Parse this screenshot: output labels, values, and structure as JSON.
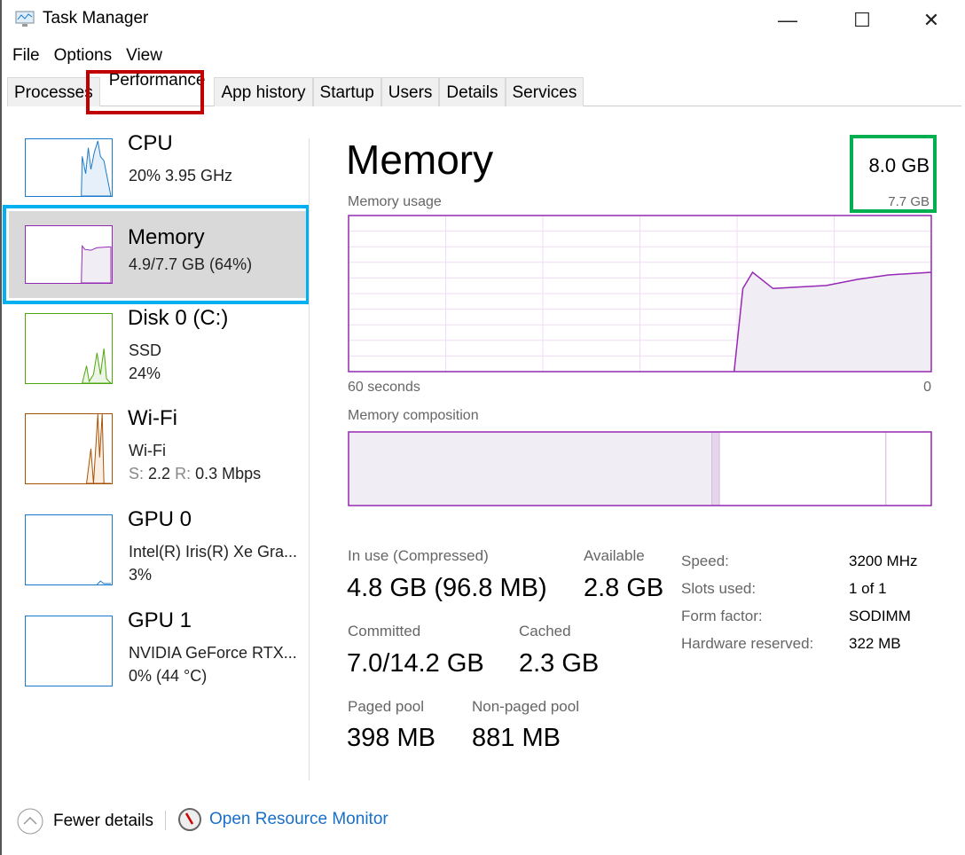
{
  "window": {
    "title": "Task Manager",
    "minimize": "—",
    "maximize": "☐",
    "close": "✕"
  },
  "menu": [
    "File",
    "Options",
    "View"
  ],
  "tabs": [
    {
      "label": "Processes"
    },
    {
      "label": "Performance",
      "active": true
    },
    {
      "label": "App history"
    },
    {
      "label": "Startup"
    },
    {
      "label": "Users"
    },
    {
      "label": "Details"
    },
    {
      "label": "Services"
    }
  ],
  "sidebar": [
    {
      "title": "CPU",
      "line1": "20%  3.95 GHz",
      "color": "#1979ca"
    },
    {
      "title": "Memory",
      "line1": "4.9/7.7 GB (64%)",
      "color": "#9528b4",
      "selected": true
    },
    {
      "title": "Disk 0 (C:)",
      "line1": "SSD",
      "line2": "24%",
      "color": "#4da60c"
    },
    {
      "title": "Wi-Fi",
      "line1": "Wi-Fi",
      "line2_s": "S:",
      "line2_sv": "2.2",
      "line2_r": "R:",
      "line2_rv": "0.3 Mbps",
      "color": "#a74f01"
    },
    {
      "title": "GPU 0",
      "line1": "Intel(R) Iris(R) Xe Gra...",
      "line2": "3%",
      "color": "#1979ca"
    },
    {
      "title": "GPU 1",
      "line1": "NVIDIA GeForce RTX...",
      "line2": "0%  (44 °C)",
      "color": "#1979ca"
    }
  ],
  "main": {
    "title": "Memory",
    "total": "8.0 GB",
    "usage_label": "Memory usage",
    "usage_max": "7.7 GB",
    "x_left": "60 seconds",
    "x_right": "0",
    "composition_label": "Memory composition",
    "stats": {
      "in_use_label": "In use (Compressed)",
      "in_use": "4.8 GB (96.8 MB)",
      "available_label": "Available",
      "available": "2.8 GB",
      "committed_label": "Committed",
      "committed": "7.0/14.2 GB",
      "cached_label": "Cached",
      "cached": "2.3 GB",
      "paged_label": "Paged pool",
      "paged": "398 MB",
      "nonpaged_label": "Non-paged pool",
      "nonpaged": "881 MB"
    },
    "specs": [
      [
        "Speed:",
        "3200 MHz"
      ],
      [
        "Slots used:",
        "1 of 1"
      ],
      [
        "Form factor:",
        "SODIMM"
      ],
      [
        "Hardware reserved:",
        "322 MB"
      ]
    ]
  },
  "chart_data": {
    "type": "area",
    "xlabel": "",
    "ylabel": "",
    "xlim": [
      60,
      0
    ],
    "ylim": [
      0,
      7.7
    ],
    "grid": true,
    "x_unit": "seconds ago",
    "y_unit": "GB",
    "color": "#9528b4",
    "points": [
      [
        20.3,
        0
      ],
      [
        19.4,
        4.1
      ],
      [
        18.4,
        4.9
      ],
      [
        16.3,
        4.1
      ],
      [
        10.8,
        4.25
      ],
      [
        7.6,
        4.55
      ],
      [
        4.4,
        4.77
      ],
      [
        0,
        4.9
      ]
    ],
    "composition": [
      {
        "part": "in use",
        "gb": 4.8
      },
      {
        "part": "modified",
        "gb": 0.1
      },
      {
        "part": "standby",
        "gb": 2.2
      },
      {
        "part": "free",
        "gb": 0.6
      }
    ]
  },
  "footer": {
    "fewer": "Fewer details",
    "monitor": "Open Resource Monitor"
  }
}
